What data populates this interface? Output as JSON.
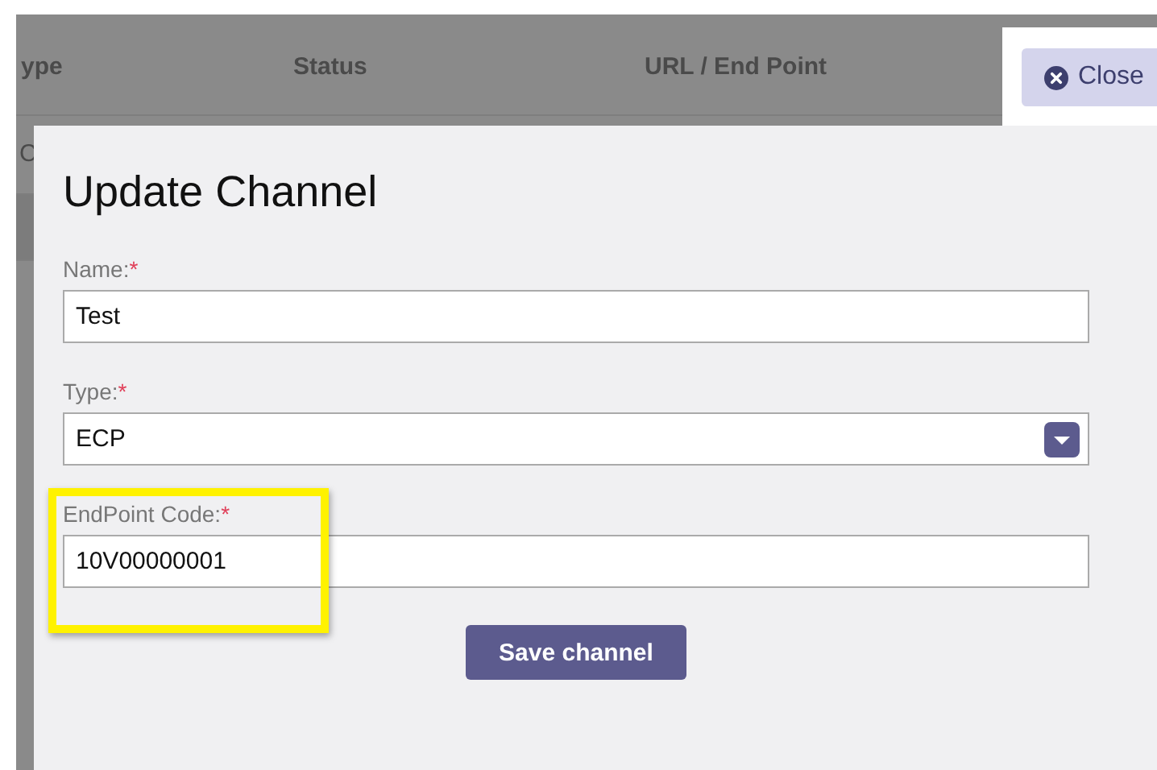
{
  "background_table": {
    "columns": [
      "ype",
      "Status",
      "URL / End Point"
    ],
    "rows": [
      [
        "C"
      ]
    ]
  },
  "close_button": {
    "label": "Close"
  },
  "dialog": {
    "title": "Update Channel",
    "fields": [
      {
        "kind": "text",
        "label": "Name:",
        "required_mark": "*",
        "value": "Test",
        "highlighted": false
      },
      {
        "kind": "select",
        "label": "Type:",
        "required_mark": "*",
        "value": "ECP",
        "highlighted": false
      },
      {
        "kind": "text",
        "label": "EndPoint Code:",
        "required_mark": "*",
        "value": "10V00000001",
        "highlighted": true
      }
    ],
    "save_button": {
      "label": "Save channel"
    }
  }
}
